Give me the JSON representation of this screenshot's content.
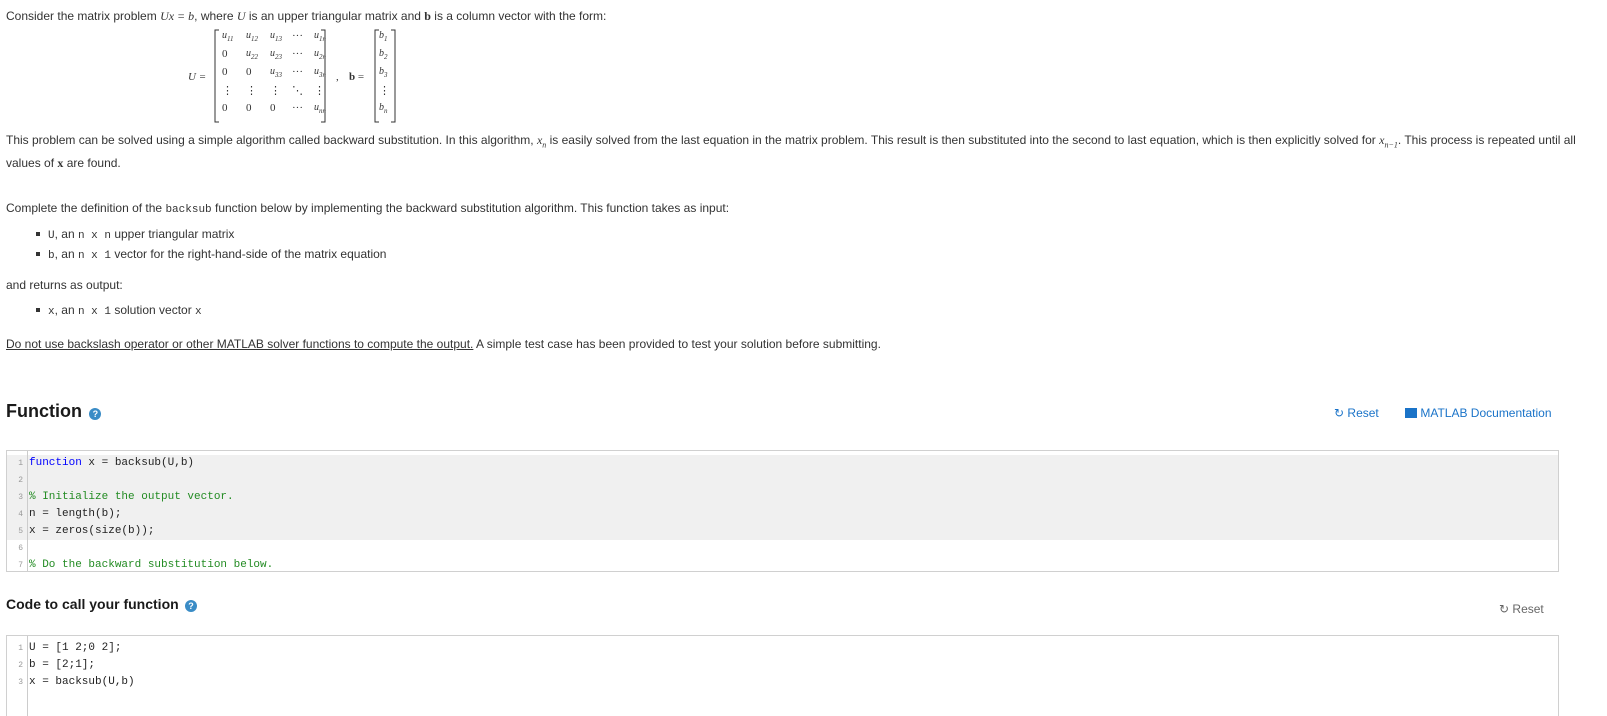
{
  "intro": {
    "text_before": "Consider the matrix problem ",
    "eq": "Ux = b",
    "text_mid": ", where ",
    "u_sym": "U",
    "text_after": " is an upper triangular matrix and ",
    "b_sym": "b",
    "text_end": " is a column vector with the form:"
  },
  "matrix": {
    "U_label": "U =",
    "b_label": "b =",
    "rows": [
      [
        "u11",
        "u12",
        "u13",
        "···",
        "u1n"
      ],
      [
        "0",
        "u22",
        "u23",
        "···",
        "u2n"
      ],
      [
        "0",
        "0",
        "u33",
        "···",
        "u3n"
      ],
      [
        "⋮",
        "⋮",
        "⋮",
        "⋱",
        "⋮"
      ],
      [
        "0",
        "0",
        "0",
        "···",
        "unn"
      ]
    ],
    "b_rows": [
      "b1",
      "b2",
      "b3",
      "⋮",
      "bn"
    ]
  },
  "para1": {
    "line1_a": "This problem can be solved using a simple algorithm called backward substitution. In this algorithm, ",
    "xn": "xn",
    "line1_b": " is easily solved from the last equation in the matrix problem. This result is then substituted into the second to last equation, which is then explicitly solved for ",
    "xn1": "xn−1",
    "line1_c": ". This process is repeated until all",
    "line2_a": "values of ",
    "x_sym": "x",
    "line2_b": " are found."
  },
  "para2": {
    "a": "Complete the definition of the ",
    "fn": "backsub",
    "b": " function below by implementing the backward substitution algorithm. This function takes as input:"
  },
  "inputs": [
    {
      "code": "U",
      "text": ", an ",
      "dim": "n x n",
      "rest": " upper triangular matrix"
    },
    {
      "code": "b",
      "text": ", an ",
      "dim": "n x 1",
      "rest": " vector for the right-hand-side of the matrix equation"
    }
  ],
  "outputs_label": "and returns as output:",
  "outputs": [
    {
      "code": "x",
      "text": ", an ",
      "dim": "n x 1",
      "rest": " solution vector ",
      "var": "x"
    }
  ],
  "warning": {
    "underlined": "Do not use backslash operator or other MATLAB solver functions to compute the output.",
    "rest": " A simple test case has been provided to test your solution before submitting."
  },
  "function_section": {
    "title": "Function",
    "help": "?",
    "reset": "Reset",
    "docs": "MATLAB Documentation",
    "lines": [
      {
        "n": "1",
        "kw": "function",
        "text": " x = backsub(U,b)",
        "locked": true
      },
      {
        "n": "2",
        "kw": "",
        "text": "",
        "locked": true
      },
      {
        "n": "3",
        "kw": "",
        "text": "% Initialize the output vector.",
        "locked": true,
        "comment": true
      },
      {
        "n": "4",
        "kw": "",
        "text": "n = length(b);",
        "locked": true
      },
      {
        "n": "5",
        "kw": "",
        "text": "x = zeros(size(b));",
        "locked": true
      },
      {
        "n": "6",
        "kw": "",
        "text": "",
        "locked": false
      },
      {
        "n": "7",
        "kw": "",
        "text": "% Do the backward substitution below.",
        "locked": false,
        "comment": true
      }
    ]
  },
  "call_section": {
    "title": "Code to call your function",
    "help": "?",
    "reset": "Reset",
    "lines": [
      {
        "n": "1",
        "text": "U = [1 2;0 2];"
      },
      {
        "n": "2",
        "text": "b = [2;1];"
      },
      {
        "n": "3",
        "text": "x = backsub(U,b)"
      }
    ]
  },
  "colors": {
    "link": "#1a73c8",
    "keyword": "#0000ff",
    "comment": "#228b22",
    "locked_bg": "#f0f0f0"
  }
}
